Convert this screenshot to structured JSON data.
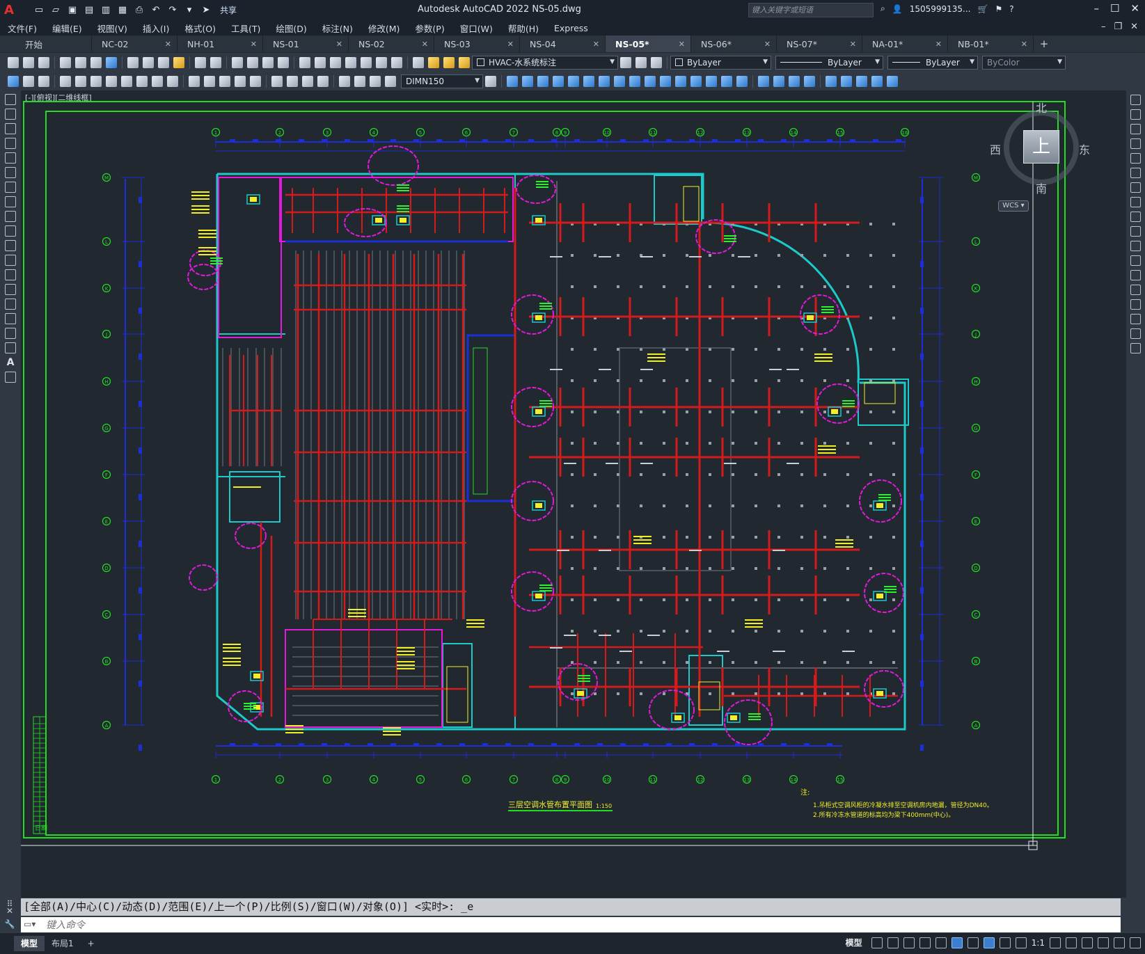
{
  "app": {
    "title": "Autodesk AutoCAD 2022    NS-05.dwg",
    "share_label": "共享",
    "search_placeholder": "键入关键字或短语",
    "user": "1505999135...",
    "logo": "A"
  },
  "menu": [
    "文件(F)",
    "编辑(E)",
    "视图(V)",
    "插入(I)",
    "格式(O)",
    "工具(T)",
    "绘图(D)",
    "标注(N)",
    "修改(M)",
    "参数(P)",
    "窗口(W)",
    "帮助(H)",
    "Express"
  ],
  "tabs": [
    {
      "label": "开始",
      "closable": false,
      "active": false
    },
    {
      "label": "NC-02",
      "closable": true,
      "active": false
    },
    {
      "label": "NH-01",
      "closable": true,
      "active": false
    },
    {
      "label": "NS-01",
      "closable": true,
      "active": false
    },
    {
      "label": "NS-02",
      "closable": true,
      "active": false
    },
    {
      "label": "NS-03",
      "closable": true,
      "active": false
    },
    {
      "label": "NS-04",
      "closable": true,
      "active": false
    },
    {
      "label": "NS-05*",
      "closable": true,
      "active": true
    },
    {
      "label": "NS-06*",
      "closable": true,
      "active": false
    },
    {
      "label": "NS-07*",
      "closable": true,
      "active": false
    },
    {
      "label": "NA-01*",
      "closable": true,
      "active": false
    },
    {
      "label": "NB-01*",
      "closable": true,
      "active": false
    }
  ],
  "toolbar": {
    "layer": "HVAC-水系统标注",
    "color": "ByLayer",
    "linetype": "ByLayer",
    "lineweight": "ByLayer",
    "plotstyle": "ByColor",
    "dimstyle": "DIMN150"
  },
  "viewport": {
    "label": "[-][俯视][二维线框]",
    "viewcube": {
      "top": "上",
      "north": "北",
      "south": "南",
      "west": "西",
      "east": "东"
    },
    "wcs": "WCS ▾"
  },
  "drawing": {
    "title": "三层空调水管布置平面图",
    "scale": "1:150",
    "notes_title": "注:",
    "notes": [
      "1.吊柜式空调风柜的冷凝水排至空调机房内地漏，管径为DN40。",
      "2.所有冷冻水管道的标高均为梁下400mm(中心)。"
    ],
    "grid_cols_top": [
      "1",
      "2",
      "3",
      "4",
      "5",
      "6",
      "7",
      "8",
      "9",
      "10",
      "11",
      "12",
      "13",
      "14",
      "15",
      "16"
    ],
    "grid_cols_bottom": [
      "1",
      "2",
      "3",
      "4",
      "5",
      "6",
      "7",
      "8",
      "9",
      "10",
      "11",
      "12",
      "13",
      "14",
      "15"
    ],
    "grid_rows": [
      "M",
      "L",
      "K",
      "J",
      "H",
      "G",
      "F",
      "E",
      "D",
      "C",
      "B",
      "A"
    ],
    "title_block_label": "日期"
  },
  "command": {
    "history": "[全部(A)/中心(C)/动态(D)/范围(E)/上一个(P)/比例(S)/窗口(W)/对象(O)] <实时>: _e",
    "placeholder": "键入命令"
  },
  "status": {
    "layout_tabs": [
      "模型",
      "布局1"
    ],
    "model_label": "模型",
    "scale": "1:1"
  },
  "colors": {
    "canvas": "#212830",
    "frame_green": "#22dd22",
    "grid_blue": "#1c2ed8",
    "pipe_red": "#d41a1a",
    "wall_cyan": "#1ec9c9",
    "cloud_magenta": "#e21ad9",
    "label_yellow": "#f0ef2a",
    "label_green": "#2ef02e"
  }
}
